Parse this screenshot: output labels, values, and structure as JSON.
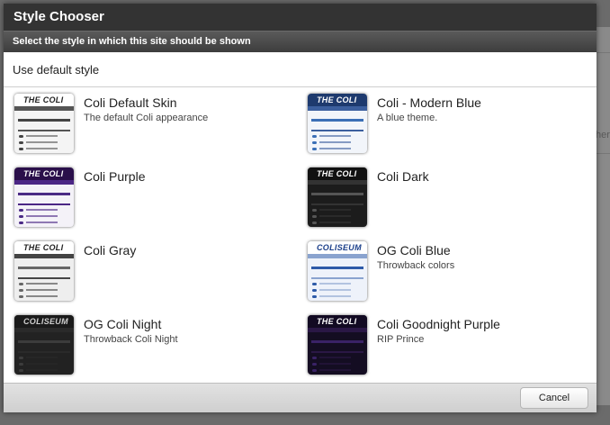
{
  "background": {
    "partial_text": "her"
  },
  "dialog": {
    "title": "Style Chooser",
    "subtitle": "Select the style in which this site should be shown",
    "default_option": "Use default style",
    "cancel_label": "Cancel"
  },
  "styles": [
    {
      "name": "Coli Default Skin",
      "description": "The default Coli appearance",
      "thumb_theme": "light",
      "colors": {
        "header": "#ffffff",
        "logo": "#222222",
        "nav": "#555555",
        "body": "#f4f4f4",
        "bar": "#444444"
      }
    },
    {
      "name": "Coli - Modern Blue",
      "description": "A blue theme.",
      "thumb_theme": "blue",
      "colors": {
        "header": "#1e3a6e",
        "logo": "#ffffff",
        "nav": "#3c5f9e",
        "body": "#f2f5fa",
        "bar": "#3b6fb6"
      }
    },
    {
      "name": "Coli Purple",
      "description": "",
      "thumb_theme": "purple",
      "colors": {
        "header": "#2a0f4a",
        "logo": "#ffffff",
        "nav": "#4b2685",
        "body": "#f4f2f8",
        "bar": "#4a2a85"
      }
    },
    {
      "name": "Coli Dark",
      "description": "",
      "thumb_theme": "dark",
      "colors": {
        "header": "#111111",
        "logo": "#ffffff",
        "nav": "#333333",
        "body": "#1c1c1c",
        "bar": "#555555"
      }
    },
    {
      "name": "Coli Gray",
      "description": "",
      "thumb_theme": "gray",
      "colors": {
        "header": "#ffffff",
        "logo": "#222222",
        "nav": "#444444",
        "body": "#eeeeee",
        "bar": "#666666"
      }
    },
    {
      "name": "OG Coli Blue",
      "description": "Throwback colors",
      "thumb_theme": "og-blue",
      "colors": {
        "header": "#ffffff",
        "logo": "#1b3f8a",
        "nav": "#8aa3cf",
        "body": "#eef2fa",
        "bar": "#2d5aa8"
      }
    },
    {
      "name": "OG Coli Night",
      "description": "Throwback Coli Night",
      "thumb_theme": "og-night",
      "colors": {
        "header": "#1a1a1a",
        "logo": "#cfcfcf",
        "nav": "#2a2a2a",
        "body": "#222222",
        "bar": "#3c3c3c"
      }
    },
    {
      "name": "Coli Goodnight Purple",
      "description": "RIP Prince",
      "thumb_theme": "goodnight",
      "colors": {
        "header": "#120a22",
        "logo": "#ffffff",
        "nav": "#2a1745",
        "body": "#140d22",
        "bar": "#3a2266"
      }
    }
  ],
  "thumb_logo_text": "THE COLI",
  "thumb_og_logo_text": "COLISEUM"
}
